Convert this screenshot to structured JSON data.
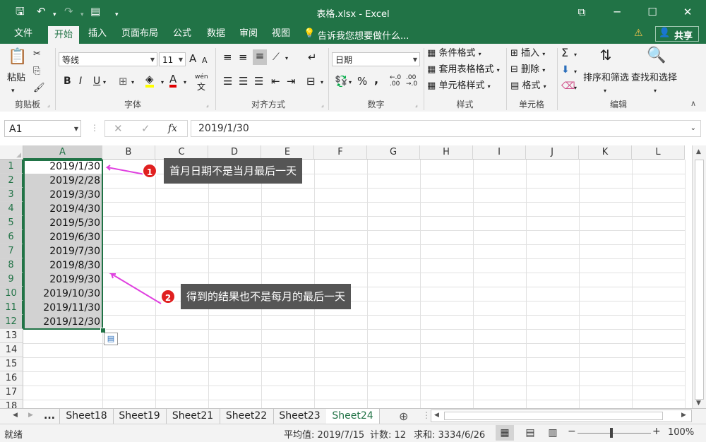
{
  "window": {
    "title": "表格.xlsx - Excel",
    "share": "共享",
    "tell_me": "告诉我您想要做什么..."
  },
  "tabs": [
    "文件",
    "开始",
    "插入",
    "页面布局",
    "公式",
    "数据",
    "审阅",
    "视图"
  ],
  "ribbon": {
    "clipboard": {
      "label": "剪贴板",
      "paste": "粘贴"
    },
    "font": {
      "label": "字体",
      "name": "等线",
      "size": "11",
      "bold": "B",
      "italic": "I",
      "underline": "U",
      "grow": "A",
      "shrink": "A",
      "color": "A",
      "phonetic": "wén"
    },
    "alignment": {
      "label": "对齐方式"
    },
    "number": {
      "label": "数字",
      "format": "日期",
      "percent": "%",
      "comma": ","
    },
    "styles": {
      "label": "样式",
      "conditional": "条件格式",
      "table": "套用表格格式",
      "cell": "单元格样式"
    },
    "cells": {
      "label": "单元格",
      "insert": "插入",
      "delete": "删除",
      "format": "格式"
    },
    "editing": {
      "label": "编辑",
      "sort": "排序和筛选",
      "find": "查找和选择",
      "sum": "Σ"
    }
  },
  "formula_bar": {
    "name_box": "A1",
    "fx": "fx",
    "value": "2019/1/30"
  },
  "columns": [
    "A",
    "B",
    "C",
    "D",
    "E",
    "F",
    "G",
    "H",
    "I",
    "J",
    "K",
    "L"
  ],
  "rows": [
    "1",
    "2",
    "3",
    "4",
    "5",
    "6",
    "7",
    "8",
    "9",
    "10",
    "11",
    "12",
    "13",
    "14",
    "15",
    "16",
    "17",
    "18"
  ],
  "cells": [
    "2019/1/30",
    "2019/2/28",
    "2019/3/30",
    "2019/4/30",
    "2019/5/30",
    "2019/6/30",
    "2019/7/30",
    "2019/8/30",
    "2019/9/30",
    "2019/10/30",
    "2019/11/30",
    "2019/12/30"
  ],
  "callouts": [
    {
      "num": "1",
      "text": "首月日期不是当月最后一天"
    },
    {
      "num": "2",
      "text": "得到的结果也不是每月的最后一天"
    }
  ],
  "sheets": {
    "more": "...",
    "tabs": [
      "Sheet18",
      "Sheet19",
      "Sheet21",
      "Sheet22",
      "Sheet23",
      "Sheet24"
    ],
    "active": "Sheet24",
    "add": "⊕"
  },
  "status": {
    "mode": "就绪",
    "average": "平均值: 2019/7/15",
    "count": "计数: 12",
    "sum": "求和: 3334/6/26",
    "zoom": "100%"
  },
  "colors": {
    "accent": "#217346",
    "callout": "#555555",
    "badge": "#e02020",
    "arrow": "#e040e0"
  }
}
